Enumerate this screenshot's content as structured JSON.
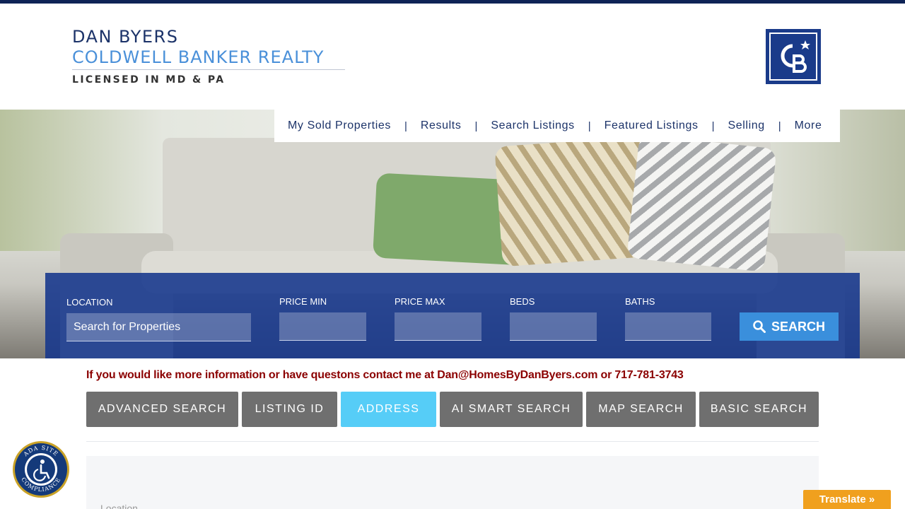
{
  "header": {
    "agent_name": "DAN BYERS",
    "brokerage": "COLDWELL BANKER REALTY",
    "license": "LICENSED IN MD & PA",
    "brand_logo": "CB"
  },
  "nav": {
    "items": [
      {
        "label": "My Sold Properties"
      },
      {
        "label": "Results"
      },
      {
        "label": "Search Listings"
      },
      {
        "label": "Featured Listings"
      },
      {
        "label": "Selling"
      },
      {
        "label": "More"
      }
    ],
    "separator": "|"
  },
  "search": {
    "location_label": "LOCATION",
    "location_placeholder": "Search for Properties",
    "price_min_label": "PRICE MIN",
    "price_max_label": "PRICE MAX",
    "beds_label": "BEDS",
    "baths_label": "BATHS",
    "button_label": "SEARCH",
    "button_icon": "search-icon"
  },
  "contact_text": "If you would like more information or have questons contact me at Dan@HomesByDanByers.com or 717-781-3743",
  "tabs": [
    {
      "label": "ADVANCED SEARCH",
      "active": false
    },
    {
      "label": "LISTING ID",
      "active": false
    },
    {
      "label": "ADDRESS",
      "active": true
    },
    {
      "label": "AI SMART SEARCH",
      "active": false
    },
    {
      "label": "MAP SEARCH",
      "active": false
    },
    {
      "label": "BASIC SEARCH",
      "active": false
    }
  ],
  "panel": {
    "location_label": "Location"
  },
  "ada_badge": {
    "text": "ADA SITE COMPLIANCE",
    "icon": "wheelchair-icon"
  },
  "translate_label": "Translate »",
  "colors": {
    "brand_navy": "#1c3369",
    "brand_blue": "#4a90d9",
    "search_panel": "#14358c",
    "search_button": "#3a8fdc",
    "active_tab": "#56cdf7",
    "inactive_tab": "#6f6f6f",
    "contact_text": "#8b0000",
    "translate": "#f0a01e"
  }
}
